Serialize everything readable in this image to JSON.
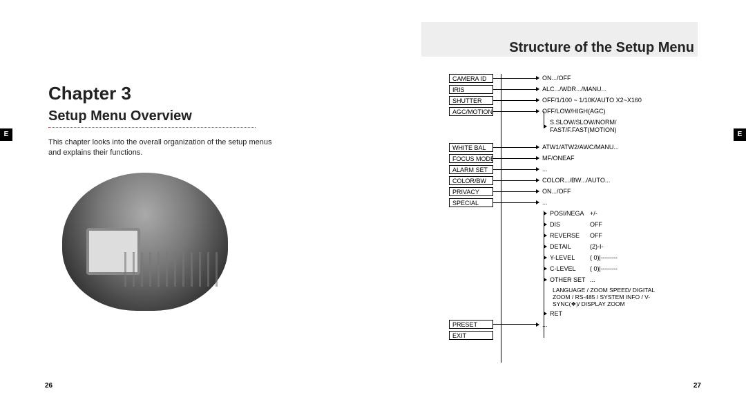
{
  "tabs": {
    "left": "E",
    "right": "E"
  },
  "pagenums": {
    "left": "26",
    "right": "27"
  },
  "leftpage": {
    "chapter": "Chapter 3",
    "subtitle": "Setup Menu Overview",
    "intro": "This chapter looks into the overall organization of the setup menus and explains their functions."
  },
  "rightpage": {
    "title": "Structure of the Setup Menu"
  },
  "menu": {
    "camera_id": {
      "label": "CAMERA ID",
      "value": "ON.../OFF"
    },
    "iris": {
      "label": "IRIS",
      "value": "ALC.../WDR.../MANU..."
    },
    "shutter": {
      "label": "SHUTTER",
      "value": "OFF/1/100 ~ 1/10K/AUTO X2~X160"
    },
    "agc_motion": {
      "label": "AGC/MOTION",
      "value1": "OFF/LOW/HIGH(AGC)",
      "value2": "S.SLOW/SLOW/NORM/\nFAST/F.FAST(MOTION)"
    },
    "white_bal": {
      "label": "WHITE BAL",
      "value": "ATW1/ATW2/AWC/MANU..."
    },
    "focus_mode": {
      "label": "FOCUS MODE",
      "value": "MF/ONEAF"
    },
    "alarm_set": {
      "label": "ALARM SET",
      "value": "..."
    },
    "color_bw": {
      "label": "COLOR/BW",
      "value": "COLOR.../BW.../AUTO..."
    },
    "privacy": {
      "label": "PRIVACY",
      "value": "ON.../OFF"
    },
    "special": {
      "label": "SPECIAL",
      "value": "...",
      "children": {
        "posi_nega": {
          "label": "POSI/NEGA",
          "value": "+/-"
        },
        "dis": {
          "label": "DIS",
          "value": "OFF"
        },
        "reverse": {
          "label": "REVERSE",
          "value": "OFF"
        },
        "detail": {
          "label": "DETAIL",
          "value": "(2)-I-"
        },
        "y_level": {
          "label": "Y-LEVEL",
          "value": "( 0)|--------"
        },
        "c_level": {
          "label": "C-LEVEL",
          "value": "( 0)|--------"
        },
        "other_set": {
          "label": "OTHER SET",
          "value": "...",
          "detail": "LANGUAGE / ZOOM SPEED/ DIGITAL ZOOM / RS-485 / SYSTEM INFO / V-SYNC(❖)/ DISPLAY ZOOM"
        },
        "ret": {
          "label": "RET",
          "value": ""
        }
      }
    },
    "preset": {
      "label": "PRESET",
      "value": "..."
    },
    "exit": {
      "label": "EXIT",
      "value": ""
    }
  }
}
